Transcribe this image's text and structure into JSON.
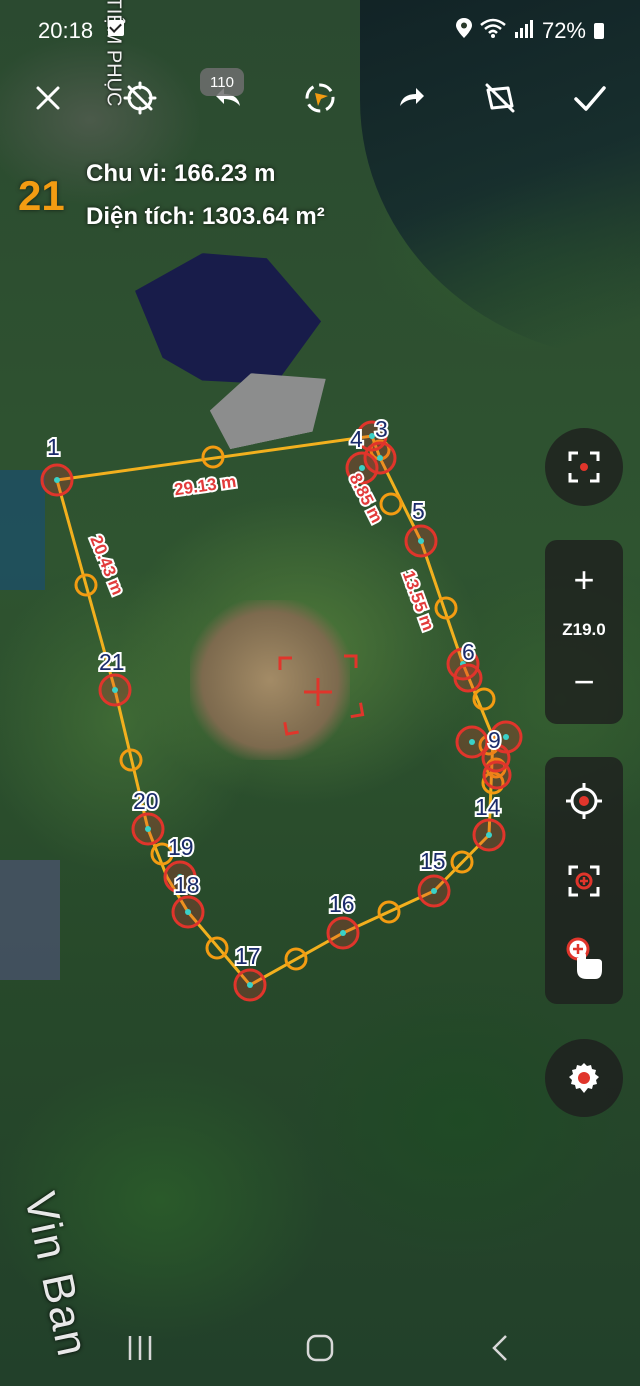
{
  "status_bar": {
    "time": "20:18",
    "battery": "72%",
    "icons": [
      "check-notification-icon",
      "location-icon",
      "wifi-icon",
      "signal-icon",
      "battery-icon"
    ]
  },
  "toolbar": {
    "buttons": [
      "close-icon",
      "disable-location-icon",
      "undo-icon",
      "compass-icon",
      "redo-icon",
      "clear-shape-icon",
      "confirm-check-icon"
    ],
    "undo_count": "110"
  },
  "measurement": {
    "point_count": "21",
    "perimeter": "Chu vi: 166.23 m",
    "area": "Diện tích: 1303.64 m²"
  },
  "map": {
    "road_label": "Vin Ban",
    "corner_label": "TIỆM PHỤC",
    "colors": {
      "polygon_line": "#f2b01e",
      "vertex_ring": "#e0352b",
      "midpoint_ring": "#f39c12",
      "vertex_center": "#3ad1c8",
      "label_text": "#1b2b6b",
      "distance_text": "#e23b3b"
    },
    "vertex_labels": [
      "1",
      "3",
      "4",
      "5",
      "6",
      "9",
      "14",
      "15",
      "16",
      "17",
      "18",
      "19",
      "20",
      "21"
    ],
    "distance_labels": [
      "29.13 m",
      "20.43 m",
      "8.85 m",
      "13.55 m"
    ]
  },
  "controls": {
    "zoom_in": "+",
    "zoom_out": "−",
    "zoom_level": "Z19.0",
    "tools": [
      "my-location-icon",
      "add-center-point-icon",
      "tap-add-point-icon"
    ],
    "settings": "settings-icon"
  },
  "nav_bar": [
    "recent-apps-icon",
    "home-icon",
    "back-icon"
  ]
}
